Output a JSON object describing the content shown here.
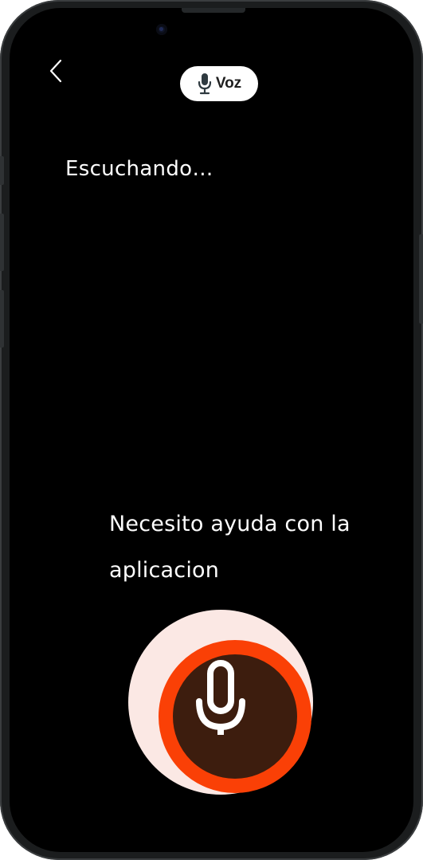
{
  "header": {
    "back_icon": "chevron-left-icon",
    "mode_pill": {
      "icon": "microphone-icon",
      "label": "Voz"
    }
  },
  "status": {
    "text": "Escuchando…"
  },
  "transcript": {
    "lines": [
      "Necesito ayuda con la",
      "aplicacion"
    ]
  },
  "mic_button": {
    "icon": "microphone-icon",
    "state": "recording"
  },
  "colors": {
    "background": "#000000",
    "accent": "#fa4006",
    "mic_inner": "#3d1d0e",
    "mic_halo": "#fbe8e4",
    "pill": "#ffffff"
  }
}
